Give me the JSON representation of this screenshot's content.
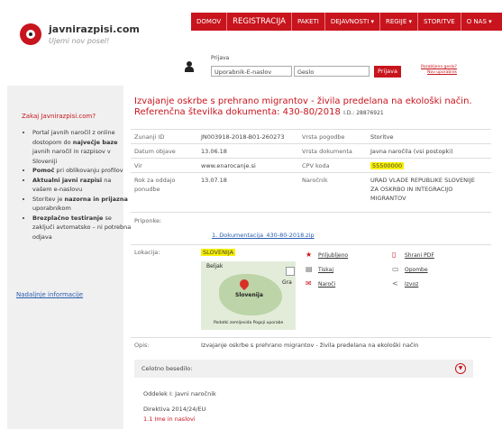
{
  "brand": {
    "name": "javnirazpisi.com",
    "slogan": "Ujemi nov posel!"
  },
  "nav": [
    "DOMOV",
    "REGISTRACIJA",
    "PAKETI",
    "DEJAVNOSTI ▾",
    "REGIJE ▾",
    "STORITVE",
    "O NAS ▾"
  ],
  "login": {
    "label": "Prijava",
    "user_placeholder": "Uporabnik-E-naslov",
    "pass_placeholder": "Geslo",
    "button": "Prijava",
    "forgot": "Pozabljeno geslo?",
    "new_user": "Nov uporabnik"
  },
  "sidebar": {
    "title": "Zakaj Javnirazpisi.com?",
    "bullets": [
      {
        "pre": "Portal javnih naročil z online dostopom do ",
        "bold": "največje baze",
        "post": " javnih naročil in razpisov v Sloveniji"
      },
      {
        "pre": "",
        "bold": "Pomoč",
        "post": " pri oblikovanju profilov"
      },
      {
        "pre": "",
        "bold": "Aktualni javni razpisi",
        "post": " na vašem e-naslovu"
      },
      {
        "pre": "Storitev je ",
        "bold": "nazorna in prijazna",
        "post": " uporabnikom"
      },
      {
        "pre": "",
        "bold": "Brezplačno testiranje",
        "post": " se zaključi avtomatsko – ni potrebna odjava"
      }
    ],
    "link": "Nadaljnje informacije"
  },
  "detail": {
    "title": "Izvajanje oskrbe s prehrano migrantov - živila predelana na ekološki način. Referenčna številka dokumenta: 430-80/2018",
    "id_info": "I.D.: 28876921",
    "rows": [
      {
        "l1": "Zunanji ID",
        "v1": "JN003918-2018-B01-260273",
        "l2": "Vrsta pogodbe",
        "v2": "Storitve"
      },
      {
        "l1": "Datum objave",
        "v1": "13.06.18",
        "l2": "Vrsta dokumenta",
        "v2": "Javna naročila (vsi postopki)"
      },
      {
        "l1": "Vir",
        "v1": "www.enarocanje.si",
        "l2": "CPV koda",
        "v2": "55500000"
      },
      {
        "l1": "Rok za oddajo ponudbe",
        "v1": "13.07.18",
        "l2": "Naročnik",
        "v2": "URAD VLADE REPUBLIKE SLOVENIJE ZA OSKRBO IN INTEGRACIJO MIGRANTOV"
      }
    ],
    "attachments_label": "Priponke:",
    "attachment": "1. Dokumentacija_430-80-2018.zip",
    "location_label": "Lokacija:",
    "location": "SLOVENIJA",
    "map": {
      "city1": "Beljak",
      "country": "Slovenija",
      "city2": "Gra",
      "footer": "Podatki zemljevida   Pogoji uporabe"
    },
    "actions": [
      "Priljubljeno",
      "Tiskaj",
      "Naroči",
      "Shrani PDF",
      "Opombe",
      "Izvoz"
    ],
    "opis_label": "Opis:",
    "opis": "Izvajanje oskrbe s prehrano migrantov - živila predelana na ekološki način",
    "full_text": "Celotno besedilo:",
    "section1": "Oddelek I: Javni naročnik",
    "directive": "Direktiva 2014/24/EU",
    "item11": "1.1 Ime in naslovi"
  },
  "colors": {
    "accent": "#c8141d",
    "highlight": "#f8f000",
    "link": "#2a5db0"
  }
}
